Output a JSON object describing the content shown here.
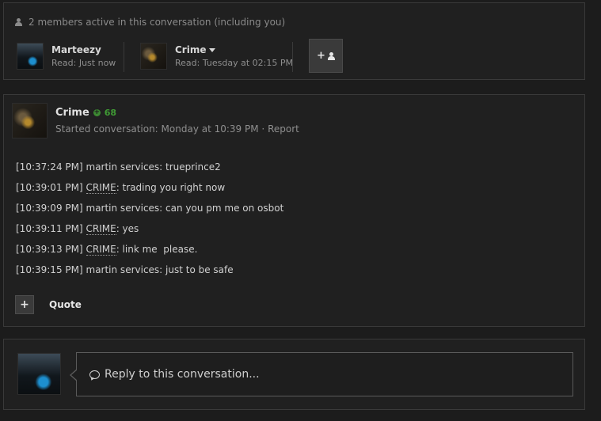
{
  "members_panel": {
    "header": "2 members active in this conversation (including you)",
    "members": [
      {
        "name": "Marteezy",
        "read": "Read: Just now",
        "avatar_icon": "car-avatar"
      },
      {
        "name": "Crime",
        "read": "Read: Tuesday at 02:15 PM",
        "avatar_icon": "crime-avatar"
      }
    ],
    "add_member_icon": "add-user-icon"
  },
  "post": {
    "author": "Crime",
    "reputation": "68",
    "rep_color": "#3f9a34",
    "meta": "Started conversation: Monday at 10:39 PM",
    "separator": "·",
    "report_label": "Report",
    "messages": [
      {
        "ts": "[10:37:24 PM]",
        "user": "martin services:",
        "text": " trueprince2"
      },
      {
        "ts": "[10:39:01 PM]",
        "user": "CRIME",
        "text": ": trading you right now"
      },
      {
        "ts": "[10:39:09 PM]",
        "user": "martin services:",
        "text": " can you pm me on osbot"
      },
      {
        "ts": "[10:39:11 PM]",
        "user": "CRIME",
        "text": ": yes"
      },
      {
        "ts": "[10:39:13 PM]",
        "user": "CRIME",
        "text": ": link me  please."
      },
      {
        "ts": "[10:39:15 PM]",
        "user": "martin services:",
        "text": " just to be safe"
      }
    ],
    "quote_add_icon": "+",
    "quote_label": "Quote"
  },
  "reply": {
    "placeholder": "Reply to this conversation..."
  }
}
